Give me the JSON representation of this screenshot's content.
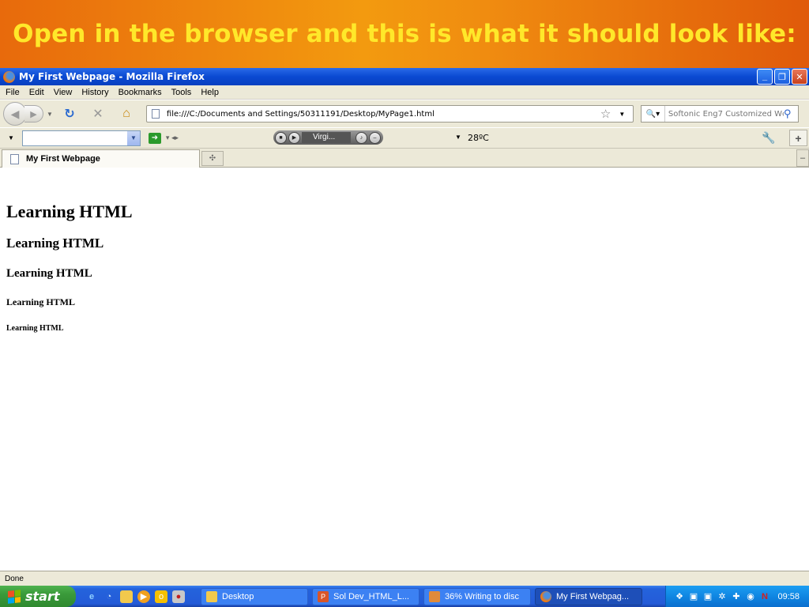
{
  "slide": {
    "title": "Open in the browser and this is what it should look like:"
  },
  "window": {
    "title": "My First Webpage - Mozilla Firefox"
  },
  "menu": {
    "items": [
      {
        "label": "File"
      },
      {
        "label": "Edit"
      },
      {
        "label": "View"
      },
      {
        "label": "History"
      },
      {
        "label": "Bookmarks"
      },
      {
        "label": "Tools"
      },
      {
        "label": "Help"
      }
    ]
  },
  "nav": {
    "url": "file:///C:/Documents and Settings/50311191/Desktop/MyPage1.html",
    "search_placeholder": "Softonic Eng7 Customized Wc"
  },
  "toolbar2": {
    "station": "Virgi...",
    "temperature": "28ºC"
  },
  "tabs": [
    {
      "label": "My First Webpage"
    }
  ],
  "page": {
    "h1": "Learning HTML",
    "h2": "Learning HTML",
    "h3": "Learning HTML",
    "h4": "Learning HTML",
    "h5": "Learning HTML"
  },
  "status": {
    "text": "Done"
  },
  "taskbar": {
    "start_label": "start",
    "tasks": [
      {
        "label": "Desktop"
      },
      {
        "label": "Sol Dev_HTML_L..."
      },
      {
        "label": "36% Writing to disc"
      },
      {
        "label": "My First Webpag..."
      }
    ],
    "clock": "09:58"
  },
  "colors": {
    "banner_text": "#ffe82a",
    "banner_bg": "#f08c10",
    "xp_blue": "#0a49d2",
    "chrome_bg": "#ece9d8"
  }
}
